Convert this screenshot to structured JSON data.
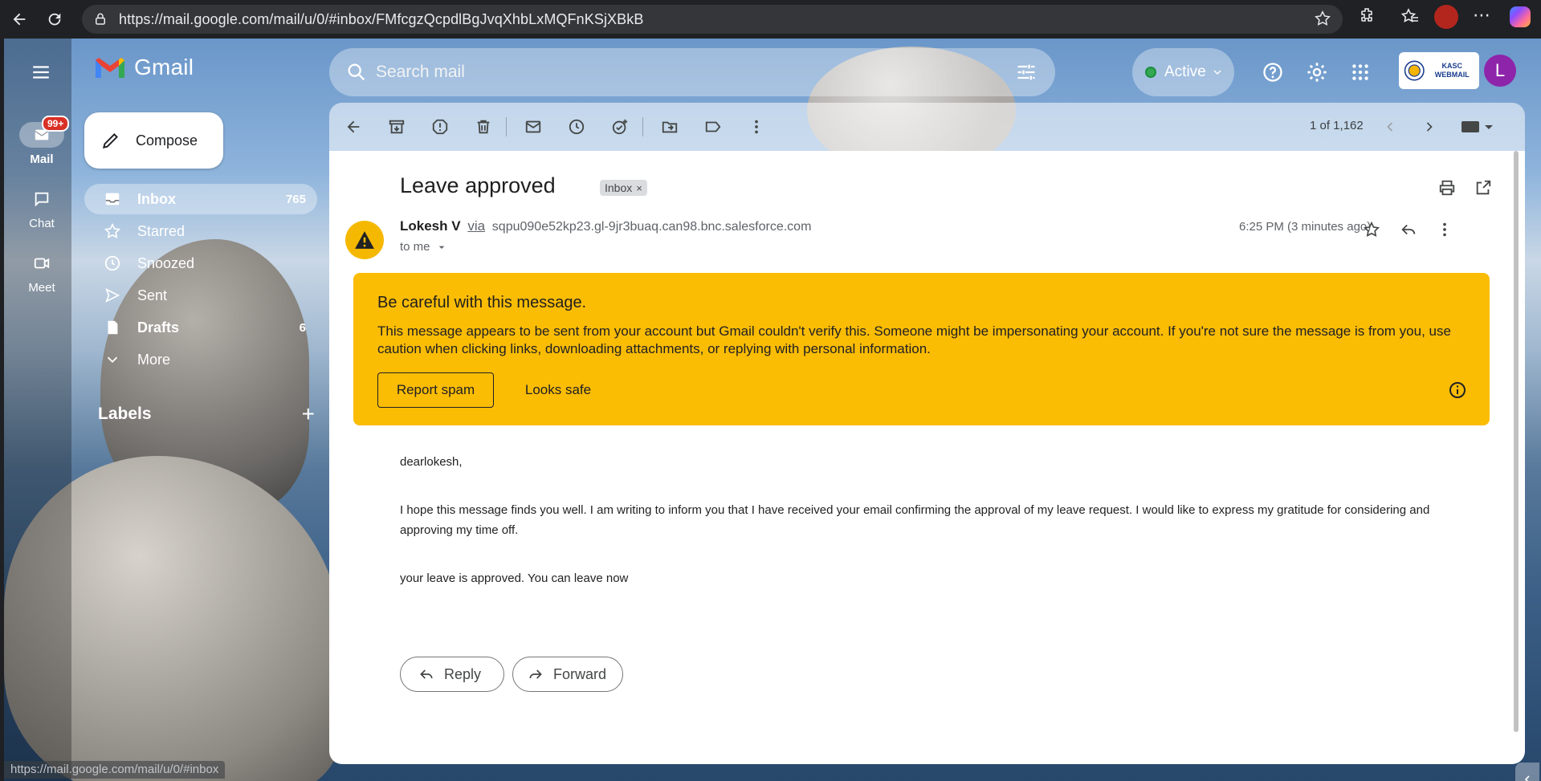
{
  "browser": {
    "url": "https://mail.google.com/mail/u/0/#inbox/FMfcgzQcpdlBgJvqXhbLxMQFnKSjXBkB",
    "status_url": "https://mail.google.com/mail/u/0/#inbox"
  },
  "app": {
    "name": "Gmail",
    "search_placeholder": "Search mail",
    "status": "Active",
    "org_badge": "KASC WEBMAIL",
    "avatar_letter": "L"
  },
  "rail": [
    {
      "label": "Mail",
      "badge": "99+",
      "active": true
    },
    {
      "label": "Chat"
    },
    {
      "label": "Meet"
    }
  ],
  "sidebar": {
    "compose_label": "Compose",
    "items": [
      {
        "label": "Inbox",
        "count": "765",
        "active": true,
        "bold": true
      },
      {
        "label": "Starred",
        "count": ""
      },
      {
        "label": "Snoozed",
        "count": ""
      },
      {
        "label": "Sent",
        "count": ""
      },
      {
        "label": "Drafts",
        "count": "6",
        "bold": true
      },
      {
        "label": "More",
        "count": ""
      }
    ],
    "labels_heading": "Labels",
    "labels_add": "+"
  },
  "toolbar": {
    "pager": "1 of 1,162"
  },
  "message": {
    "subject": "Leave approved",
    "chip": "Inbox",
    "chip_close": "×",
    "sender_name": "Lokesh V",
    "via": "via",
    "via_address": "sqpu090e52kp23.gl-9jr3buaq.can98.bnc.salesforce.com",
    "to": "to me",
    "time": "6:25 PM (3 minutes ago)",
    "warning": {
      "title": "Be careful with this message.",
      "body": "This message appears to be sent from your account but Gmail couldn't verify this. Someone might be impersonating your account. If you're not sure the message is from you, use caution when clicking links, downloading attachments, or replying with personal information.",
      "report_label": "Report spam",
      "safe_label": "Looks safe"
    },
    "body": [
      "dearlokesh,",
      "I hope this message finds you well. I am writing to inform you that I have received your email confirming the approval of my leave request. I would like to express my gratitude for considering and approving my time off.",
      "your leave is approved. You can leave now"
    ],
    "reply_label": "Reply",
    "forward_label": "Forward"
  },
  "colors": {
    "warning_bg": "#fbbc04",
    "avatar_bg": "#8e24aa",
    "badge_red": "#d93025",
    "active_green": "#34a853"
  }
}
